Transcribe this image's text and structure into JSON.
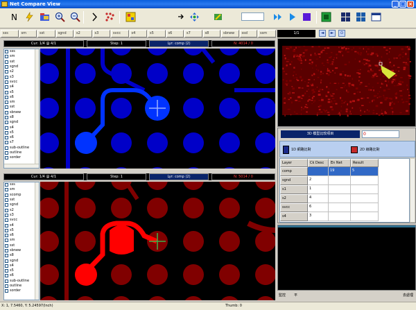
{
  "app": {
    "title": "Net Compare View"
  },
  "toolbar": {
    "buttons": [
      {
        "name": "new-icon"
      },
      {
        "name": "lightning-icon"
      },
      {
        "name": "folder-icon"
      },
      {
        "name": "zoom-in-icon"
      },
      {
        "name": "zoom-out-icon"
      },
      {
        "name": "step-forward-icon"
      },
      {
        "name": "grid-dots-icon"
      },
      {
        "name": "select-icon"
      },
      {
        "name": "move-icon"
      },
      {
        "name": "pencil-icon"
      },
      {
        "name": "fast-forward-icon"
      },
      {
        "name": "play-icon"
      },
      {
        "name": "stop-icon"
      },
      {
        "name": "layout-icon"
      },
      {
        "name": "board-icon"
      },
      {
        "name": "tile-icon"
      }
    ]
  },
  "layer_tabs": [
    "sss",
    "sm",
    "sst",
    "sgnd",
    "s2",
    "s3",
    "svcc",
    "s4",
    "s5",
    "s6",
    "s7",
    "s8",
    "sbnew",
    "ssd",
    "ssm"
  ],
  "top_pane": {
    "coords": "Cur: 1/4 @ 4/1",
    "step": "Step: 1",
    "layer_comp": "Lyr: comp (2)",
    "net": "N: 4014 / 0"
  },
  "bottom_pane": {
    "coords": "Cur: 1/4 @ 4/1",
    "step": "Step: 1",
    "layer_comp": "Lyr: comp (2)",
    "net": "N: 5014 / 0"
  },
  "layer_list_top": [
    "sss",
    "sm",
    "sst",
    "sgnd",
    "s2",
    "s3",
    "svcc",
    "s4",
    "s5",
    "s6",
    "sm",
    "sst",
    "sbnew",
    "s8",
    "sgnd",
    "s4",
    "s5",
    "s6",
    "s7",
    "sub-outline",
    "outline",
    "sorder"
  ],
  "layer_list_bottom": [
    "sss",
    "sm",
    "scomp",
    "sst",
    "sgnd",
    "s2",
    "s3",
    "svcc",
    "s4",
    "s5",
    "s6",
    "sm",
    "sst",
    "sbnew",
    "s8",
    "sgnd",
    "s4",
    "s5",
    "s6",
    "sub-outline",
    "outline",
    "sorder"
  ],
  "minimap": {
    "zoom_label": "1/1"
  },
  "defect_panel": {
    "title": "3D 模型比较項目",
    "count_value": "0",
    "tab_left": "1D 網路比對",
    "tab_right": "2D 線路比對",
    "columns": [
      "Layer",
      "Ck Desc",
      "En Net",
      "Result"
    ],
    "rows": [
      {
        "layer": "comp",
        "desc": "",
        "net": "19",
        "result": "5"
      },
      {
        "layer": "sgnd",
        "desc": "2",
        "net": "",
        "result": ""
      },
      {
        "layer": "s1",
        "desc": "1",
        "net": "",
        "result": ""
      },
      {
        "layer": "s2",
        "desc": "4",
        "net": "",
        "result": ""
      },
      {
        "layer": "svcc",
        "desc": "6",
        "net": "",
        "result": ""
      },
      {
        "layer": "s4",
        "desc": "3",
        "net": "",
        "result": ""
      }
    ]
  },
  "log_footer": {
    "left": "監控",
    "mid": "平",
    "right": "去處理"
  },
  "statusbar": {
    "left": "X: 1, 7.5460, Y: 5.24597(Inch)",
    "right": "Thumb: 0"
  },
  "colors": {
    "top_copper": "#0000c8",
    "top_highlight": "#0033ff",
    "bottom_copper": "#800000",
    "bottom_highlight": "#ff0000",
    "marker_top": "#9ab0ff",
    "marker_bottom": "#3bb34a"
  }
}
